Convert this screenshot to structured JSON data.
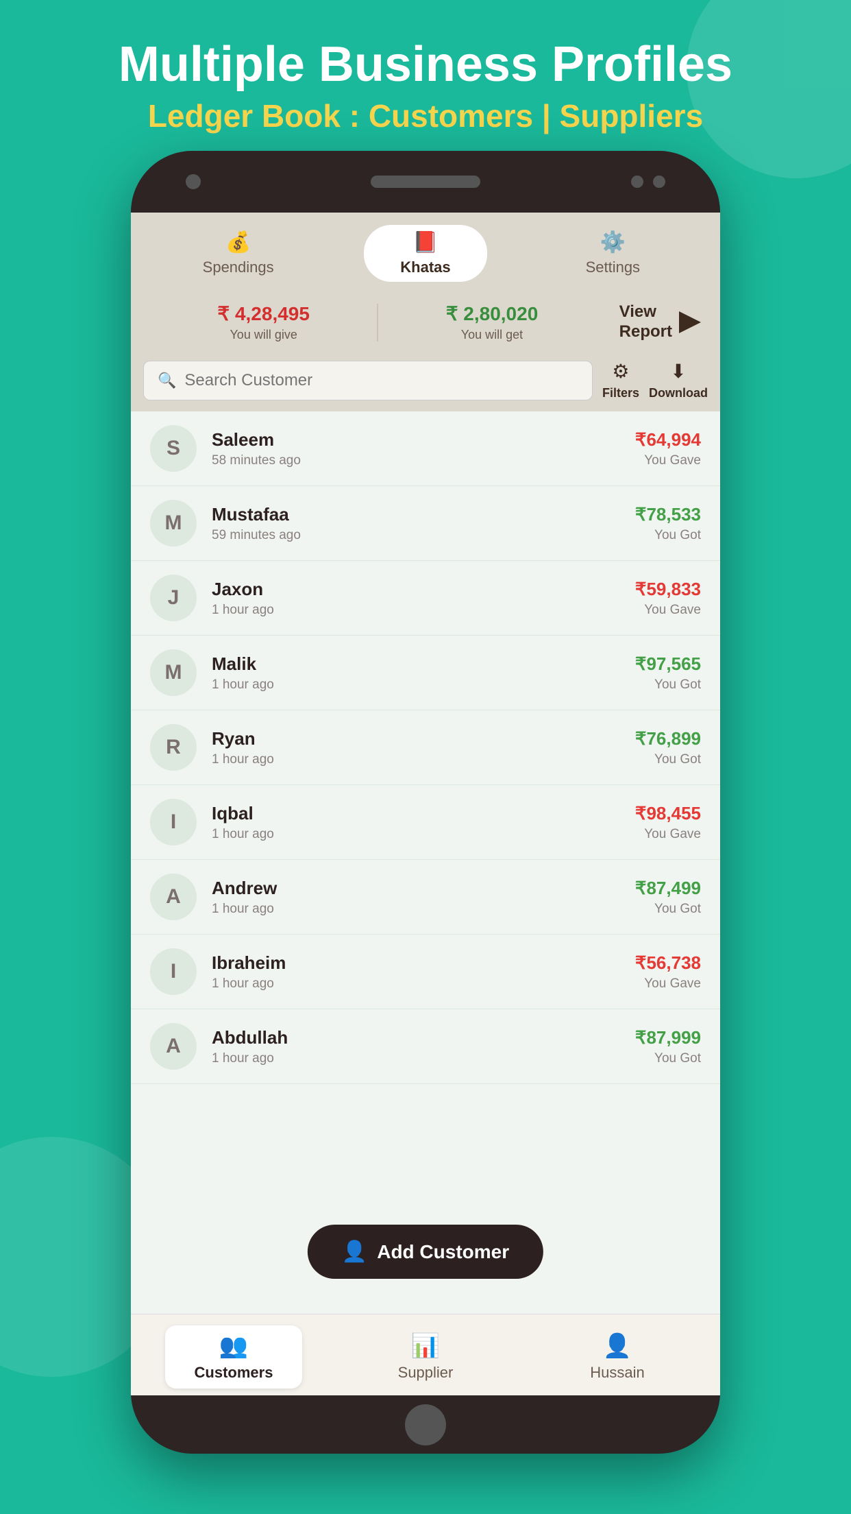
{
  "header": {
    "title": "Multiple Business Profiles",
    "subtitle": "Ledger Book : Customers | Suppliers"
  },
  "nav_tabs": [
    {
      "id": "spendings",
      "label": "Spendings",
      "icon": "💰",
      "active": false
    },
    {
      "id": "khatas",
      "label": "Khatas",
      "icon": "📕",
      "active": true
    },
    {
      "id": "settings",
      "label": "Settings",
      "icon": "⚙️",
      "active": false
    }
  ],
  "summary": {
    "give_amount": "₹ 4,28,495",
    "give_label": "You will give",
    "get_amount": "₹ 2,80,020",
    "get_label": "You will get",
    "view_report_label": "View\nReport"
  },
  "search": {
    "placeholder": "Search Customer",
    "filters_label": "Filters",
    "download_label": "Download"
  },
  "customers": [
    {
      "initial": "S",
      "name": "Saleem",
      "time": "58 minutes ago",
      "amount": "₹64,994",
      "status": "You Gave",
      "amount_color": "red"
    },
    {
      "initial": "M",
      "name": "Mustafaa",
      "time": "59 minutes ago",
      "amount": "₹78,533",
      "status": "You Got",
      "amount_color": "green"
    },
    {
      "initial": "J",
      "name": "Jaxon",
      "time": "1 hour ago",
      "amount": "₹59,833",
      "status": "You Gave",
      "amount_color": "red"
    },
    {
      "initial": "M",
      "name": "Malik",
      "time": "1 hour ago",
      "amount": "₹97,565",
      "status": "You Got",
      "amount_color": "green"
    },
    {
      "initial": "R",
      "name": "Ryan",
      "time": "1 hour ago",
      "amount": "₹76,899",
      "status": "You Got",
      "amount_color": "green"
    },
    {
      "initial": "I",
      "name": "Iqbal",
      "time": "1 hour ago",
      "amount": "₹98,455",
      "status": "You Gave",
      "amount_color": "red"
    },
    {
      "initial": "A",
      "name": "Andrew",
      "time": "1 hour ago",
      "amount": "₹87,499",
      "status": "You Got",
      "amount_color": "green"
    },
    {
      "initial": "I",
      "name": "Ibraheim",
      "time": "1 hour ago",
      "amount": "₹56,738",
      "status": "You Gave",
      "amount_color": "red"
    },
    {
      "initial": "A",
      "name": "Abdullah",
      "time": "1 hour ago",
      "amount": "₹87,999",
      "status": "You Got",
      "amount_color": "green"
    }
  ],
  "add_customer_label": "Add Customer",
  "bottom_nav": [
    {
      "id": "customers",
      "label": "Customers",
      "icon": "👥",
      "active": true
    },
    {
      "id": "supplier",
      "label": "Supplier",
      "icon": "📊",
      "active": false
    },
    {
      "id": "hussain",
      "label": "Hussain",
      "icon": "👤",
      "active": false
    }
  ]
}
